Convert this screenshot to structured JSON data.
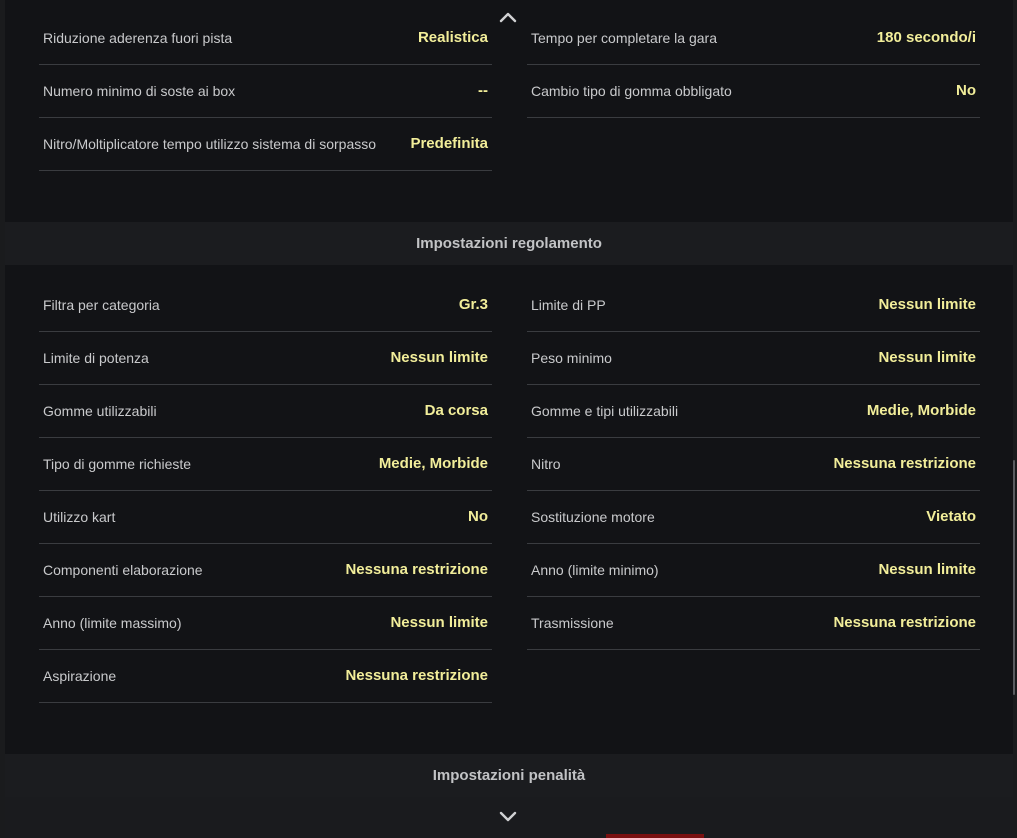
{
  "race_settings": {
    "left": [
      {
        "label": "Riduzione aderenza fuori pista",
        "value": "Realistica"
      },
      {
        "label": "Numero minimo di soste ai box",
        "value": "--"
      },
      {
        "label": "Nitro/Moltiplicatore tempo utilizzo sistema di sorpasso",
        "value": "Predefinita"
      }
    ],
    "right": [
      {
        "label": "Tempo per completare la gara",
        "value": "180 secondo/i"
      },
      {
        "label": "Cambio tipo di gomma obbligato",
        "value": "No"
      }
    ]
  },
  "regulations": {
    "title": "Impostazioni regolamento",
    "left": [
      {
        "label": "Filtra per categoria",
        "value": "Gr.3"
      },
      {
        "label": "Limite di potenza",
        "value": "Nessun limite"
      },
      {
        "label": "Gomme utilizzabili",
        "value": "Da corsa"
      },
      {
        "label": "Tipo di gomme richieste",
        "value": "Medie, Morbide"
      },
      {
        "label": "Utilizzo kart",
        "value": "No"
      },
      {
        "label": "Componenti elaborazione",
        "value": "Nessuna restrizione"
      },
      {
        "label": "Anno (limite massimo)",
        "value": "Nessun limite"
      },
      {
        "label": "Aspirazione",
        "value": "Nessuna restrizione"
      }
    ],
    "right": [
      {
        "label": "Limite di PP",
        "value": "Nessun limite"
      },
      {
        "label": "Peso minimo",
        "value": "Nessun limite"
      },
      {
        "label": "Gomme e tipi utilizzabili",
        "value": "Medie, Morbide"
      },
      {
        "label": "Nitro",
        "value": "Nessuna restrizione"
      },
      {
        "label": "Sostituzione motore",
        "value": "Vietato"
      },
      {
        "label": "Anno (limite minimo)",
        "value": "Nessun limite"
      },
      {
        "label": "Trasmissione",
        "value": "Nessuna restrizione"
      }
    ]
  },
  "penalties": {
    "title": "Impostazioni penalità"
  },
  "icons": {
    "scroll_up": "chevron-up-icon",
    "scroll_down": "chevron-down-icon"
  },
  "colors": {
    "value_text": "#f2ee9a",
    "label_text": "#c9cacc",
    "header_text": "#c2c3c5"
  }
}
